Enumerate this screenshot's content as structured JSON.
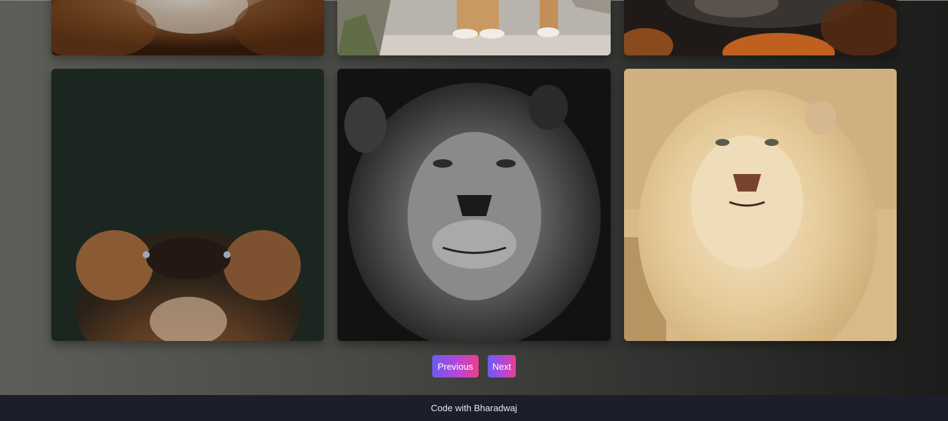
{
  "gallery": {
    "images": [
      {
        "subject": "lion-mane-closeup"
      },
      {
        "subject": "lioness-paws-on-rock"
      },
      {
        "subject": "lion-dark-mane-paw"
      },
      {
        "subject": "lioness-looking-up"
      },
      {
        "subject": "lion-black-and-white-portrait"
      },
      {
        "subject": "white-lion-portrait"
      }
    ]
  },
  "pagination": {
    "previous_label": "Previous",
    "next_label": "Next"
  },
  "footer": {
    "credit": "Code with Bharadwaj"
  },
  "colors": {
    "button_gradient_start": "#6b5cf0",
    "button_gradient_end": "#ec3f8a",
    "footer_bg": "#1a1f2b"
  }
}
